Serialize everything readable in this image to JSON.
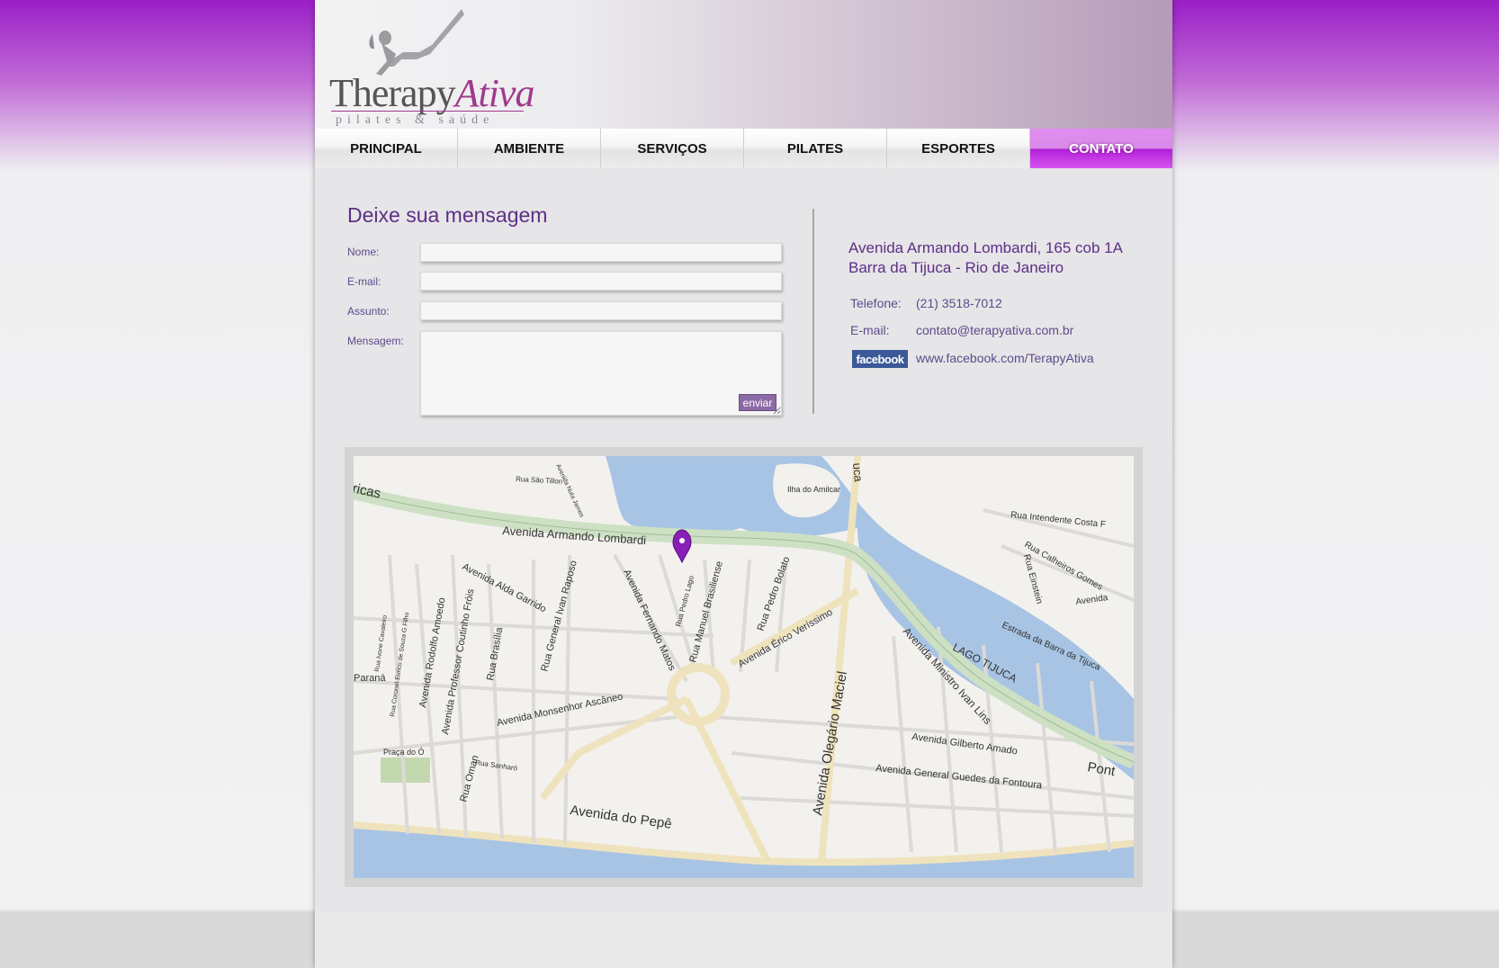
{
  "brand": {
    "name_part1": "Therapy",
    "name_part2": "Ativa",
    "tagline": "pilates & saúde",
    "accent_color": "#a03a8c"
  },
  "nav": {
    "items": [
      "PRINCIPAL",
      "AMBIENTE",
      "SERVIÇOS",
      "PILATES",
      "ESPORTES",
      "CONTATO"
    ],
    "active_index": 5,
    "active_color": "#c03ae0"
  },
  "form": {
    "title": "Deixe sua mensagem",
    "name_label": "Nome:",
    "email_label": "E-mail:",
    "subject_label": "Assunto:",
    "message_label": "Mensagem:",
    "name_value": "",
    "email_value": "",
    "subject_value": "",
    "message_value": "",
    "submit_label": "enviar"
  },
  "contact": {
    "address_line1": "Avenida Armando Lombardi, 165 cob 1A",
    "address_line2": "Barra da Tijuca - Rio de Janeiro",
    "phone_label": "Telefone:",
    "phone": "(21) 3518-7012",
    "email_label": "E-mail:",
    "email": "contato@terapyativa.com.br",
    "facebook_badge": "facebook",
    "facebook_url": "www.facebook.com/TerapyAtiva"
  },
  "map": {
    "streets": [
      "Avenida Armando Lombardi",
      "Avenida Alda Garrido",
      "Rua General Ivan Raposo",
      "Avenida Fernando Matos",
      "Rua Pedro Lago",
      "Rua Manuel Brasiliense",
      "Rua Pedro Bolato",
      "Avenida Érico Veríssimo",
      "Avenida Olegário Maciel",
      "Avenida Ministro Ivan Lins",
      "Avenida Monsenhor Ascâneo",
      "Avenida Rodolfo Amoedo",
      "Avenida Professor Coutinho Fróis",
      "Rua Brasília",
      "Rua Coronel Eurico de Souza G Filho",
      "Rua Ivone Cavaleiro",
      "Rua Oman",
      "Rua Sanharó",
      "Avenida do Pepê",
      "Avenida Gilberto Amado",
      "Avenida General Guedes da Fontoura",
      "Rua Intendente Costa F",
      "Rua Calheiros Gomes",
      "Rua Einstein",
      "Estrada da Barra da Tijuca",
      "Rua São Tillon",
      "Avenida Nuta James",
      "Avenida",
      "Pont",
      "ricas",
      "uca",
      "Paraná"
    ],
    "places": [
      "Ilha do Amilcar",
      "LAGO TIJUCA",
      "Praça do Ó"
    ],
    "pin_color": "#8a1fb8"
  }
}
